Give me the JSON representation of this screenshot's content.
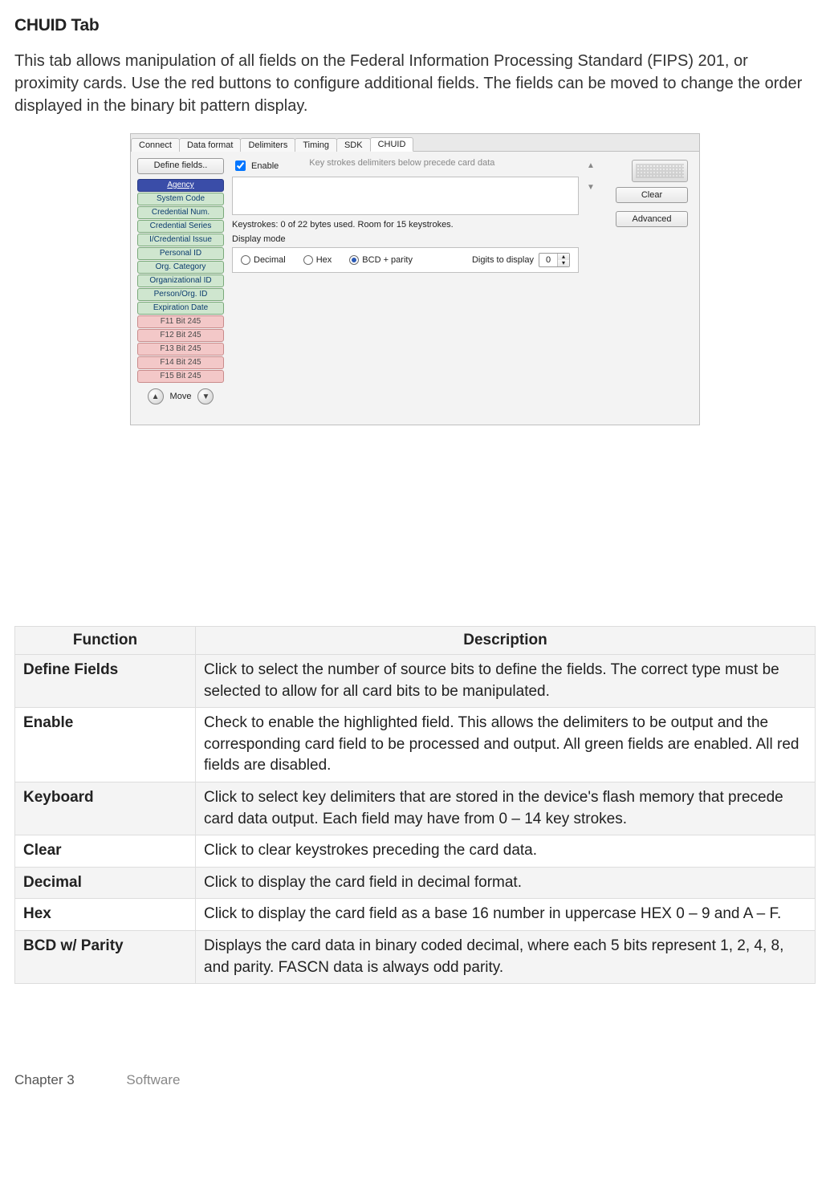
{
  "heading": "CHUID Tab",
  "intro": "This tab allows manipulation of all fields on the Federal Information Processing Standard (FIPS) 201, or proximity cards. Use the red buttons to configure additional fields. The fields can be moved to change the order displayed in the binary bit pattern display.",
  "panel": {
    "tabs": [
      "Connect",
      "Data format",
      "Delimiters",
      "Timing",
      "SDK",
      "CHUID"
    ],
    "active_tab": 5,
    "define_button": "Define fields..",
    "fields": [
      {
        "label": "Agency",
        "style": "blue"
      },
      {
        "label": "System Code",
        "style": "green"
      },
      {
        "label": "Credential Num.",
        "style": "green"
      },
      {
        "label": "Credential Series",
        "style": "green"
      },
      {
        "label": "I/Credential Issue",
        "style": "green"
      },
      {
        "label": "Personal ID",
        "style": "green"
      },
      {
        "label": "Org. Category",
        "style": "green"
      },
      {
        "label": "Organizational ID",
        "style": "green"
      },
      {
        "label": "Person/Org. ID",
        "style": "green"
      },
      {
        "label": "Expiration Date",
        "style": "green"
      },
      {
        "label": "F11 Bit 245",
        "style": "red"
      },
      {
        "label": "F12 Bit 245",
        "style": "red"
      },
      {
        "label": "F13 Bit 245",
        "style": "red"
      },
      {
        "label": "F14 Bit 245",
        "style": "red"
      },
      {
        "label": "F15 Bit 245",
        "style": "red"
      }
    ],
    "move_label": "Move",
    "enable_label": "Enable",
    "enable_checked": true,
    "hint": "Key strokes delimiters below precede card data",
    "keystrokes_line": "Keystrokes: 0 of 22 bytes used. Room for 15 keystrokes.",
    "display_mode_label": "Display mode",
    "radios": {
      "decimal": "Decimal",
      "hex": "Hex",
      "bcd": "BCD  + parity"
    },
    "radio_selected": "bcd",
    "digits_label": "Digits to display",
    "digits_value": "0",
    "clear_button": "Clear",
    "advanced_button": "Advanced"
  },
  "table": {
    "headers": {
      "function": "Function",
      "description": "Description"
    },
    "rows": [
      {
        "fn": "Define Fields",
        "desc": "Click to select the number of source bits to define the fields. The correct type must be selected to allow for all card bits to be manipulated."
      },
      {
        "fn": "Enable",
        "desc": "Check to enable the highlighted field. This allows the delimiters to be output and the corresponding card field to be processed and output. All green fields are enabled. All red fields are disabled."
      },
      {
        "fn": "Keyboard",
        "desc": "Click to select key delimiters that are stored in the device's flash memory that precede card data output. Each field may have from 0 – 14 key strokes."
      },
      {
        "fn": "Clear",
        "desc": "Click to clear keystrokes preceding the card data."
      },
      {
        "fn": "Decimal",
        "desc": "Click to display the card field in decimal format."
      },
      {
        "fn": "Hex",
        "desc": "Click to display the card field as a base 16 number in uppercase HEX 0 – 9 and A – F."
      },
      {
        "fn": "BCD w/ Parity",
        "desc": "Displays the card data in binary coded decimal, where each 5 bits represent 1, 2, 4, 8, and parity. FASCN data is always odd parity."
      }
    ]
  },
  "footer": {
    "chapter": "Chapter 3",
    "section": "Software"
  }
}
